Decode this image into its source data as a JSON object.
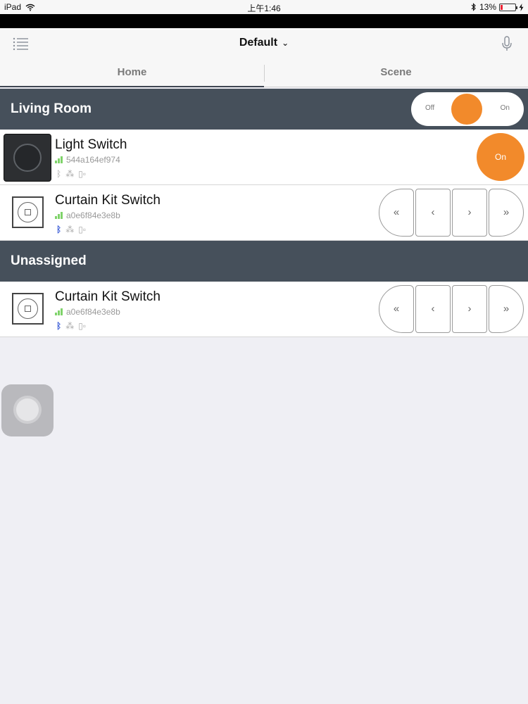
{
  "status_bar": {
    "device": "iPad",
    "time": "上午1:46",
    "battery": "13%",
    "battery_level": 0.13
  },
  "nav": {
    "title": "Default"
  },
  "tabs": [
    {
      "label": "Home",
      "active": true
    },
    {
      "label": "Scene",
      "active": false
    }
  ],
  "groups": [
    {
      "name": "Living Room",
      "toggle": {
        "off_label": "Off",
        "on_label": "On"
      },
      "devices": [
        {
          "name": "Light Switch",
          "id": "544a164ef974",
          "action_label": "On"
        },
        {
          "name": "Curtain Kit Switch",
          "id": "a0e6f84e3e8b",
          "controls": [
            "«",
            "‹",
            "›",
            "»"
          ]
        }
      ]
    },
    {
      "name": "Unassigned",
      "devices": [
        {
          "name": "Curtain Kit Switch",
          "id": "a0e6f84e3e8b",
          "controls": [
            "«",
            "‹",
            "›",
            "»"
          ]
        }
      ]
    }
  ],
  "colors": {
    "accent": "#f28a2b",
    "header": "#46505b",
    "bluetooth_active": "#4060d8"
  }
}
